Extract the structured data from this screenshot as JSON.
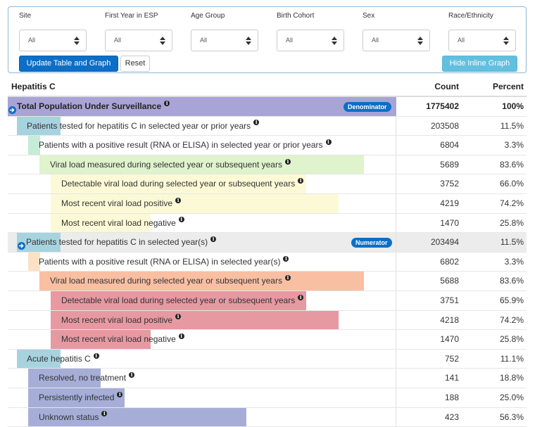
{
  "filters": [
    {
      "label": "Site",
      "value": "All"
    },
    {
      "label": "First Year in ESP",
      "value": "All"
    },
    {
      "label": "Age Group",
      "value": "All"
    },
    {
      "label": "Birth Cohort",
      "value": "All"
    },
    {
      "label": "Sex",
      "value": "All"
    },
    {
      "label": "Race/Ethnicity",
      "value": "All"
    }
  ],
  "buttons": {
    "update": "Update Table and Graph",
    "reset": "Reset",
    "hide_graph": "Hide Inline Graph"
  },
  "table": {
    "title": "Hepatitis C",
    "count_header": "Count",
    "percent_header": "Percent",
    "rows": [
      {
        "label": "Total Population Under Surveillance",
        "count": "1775402",
        "percent": "100%",
        "badge": "Denominator",
        "fill_fraction": 1.0,
        "color": "#a8a4d6"
      },
      {
        "label": "Patients tested for hepatitis C in selected year or prior years",
        "count": "203508",
        "percent": "11.5%",
        "fill_fraction": 0.115,
        "color": "#a7d3df"
      },
      {
        "label": "Patients with a positive result (RNA or ELISA) in selected year or prior years",
        "count": "6804",
        "percent": "3.3%",
        "fill_fraction": 0.033,
        "color": "#c6ebd6"
      },
      {
        "label": "Viral load measured during selected year or subsequent years",
        "count": "5689",
        "percent": "83.6%",
        "fill_fraction": 0.836,
        "color": "#dff3cc"
      },
      {
        "label": "Detectable viral load during selected year or subsequent years",
        "count": "3752",
        "percent": "66.0%",
        "fill_fraction": 0.66,
        "color": "#fcfad6"
      },
      {
        "label": "Most recent viral load positive",
        "count": "4219",
        "percent": "74.2%",
        "fill_fraction": 0.742,
        "color": "#fcfad6"
      },
      {
        "label": "Most recent viral load negative",
        "count": "1470",
        "percent": "25.8%",
        "fill_fraction": 0.258,
        "color": "#fcfad6"
      },
      {
        "label": "Patients tested for hepatitis C in selected year(s)",
        "count": "203494",
        "percent": "11.5%",
        "badge": "Numerator",
        "fill_fraction": 0.115,
        "color": "#a7d3df"
      },
      {
        "label": "Patients with a positive result (RNA or ELISA) in selected year(s)",
        "count": "6802",
        "percent": "3.3%",
        "fill_fraction": 0.033,
        "color": "#fde1c3"
      },
      {
        "label": "Viral load measured during selected year or subsequent years",
        "count": "5688",
        "percent": "83.6%",
        "fill_fraction": 0.836,
        "color": "#f9bfa3"
      },
      {
        "label": "Detectable viral load during selected year or subsequent years",
        "count": "3751",
        "percent": "65.9%",
        "fill_fraction": 0.659,
        "color": "#e799a2"
      },
      {
        "label": "Most recent viral load positive",
        "count": "4218",
        "percent": "74.2%",
        "fill_fraction": 0.742,
        "color": "#e799a2"
      },
      {
        "label": "Most recent viral load negative",
        "count": "1470",
        "percent": "25.8%",
        "fill_fraction": 0.258,
        "color": "#e799a2"
      },
      {
        "label": "Acute hepatitis C",
        "count": "752",
        "percent": "11.1%",
        "fill_fraction": 0.111,
        "color": "#a7d3df"
      },
      {
        "label": "Resolved, no treatment",
        "count": "141",
        "percent": "18.8%",
        "fill_fraction": 0.188,
        "color": "#a6aed8"
      },
      {
        "label": "Persistently infected",
        "count": "188",
        "percent": "25.0%",
        "fill_fraction": 0.25,
        "color": "#a6aed8"
      },
      {
        "label": "Unknown status",
        "count": "423",
        "percent": "56.3%",
        "fill_fraction": 0.563,
        "color": "#a6aed8"
      }
    ]
  }
}
